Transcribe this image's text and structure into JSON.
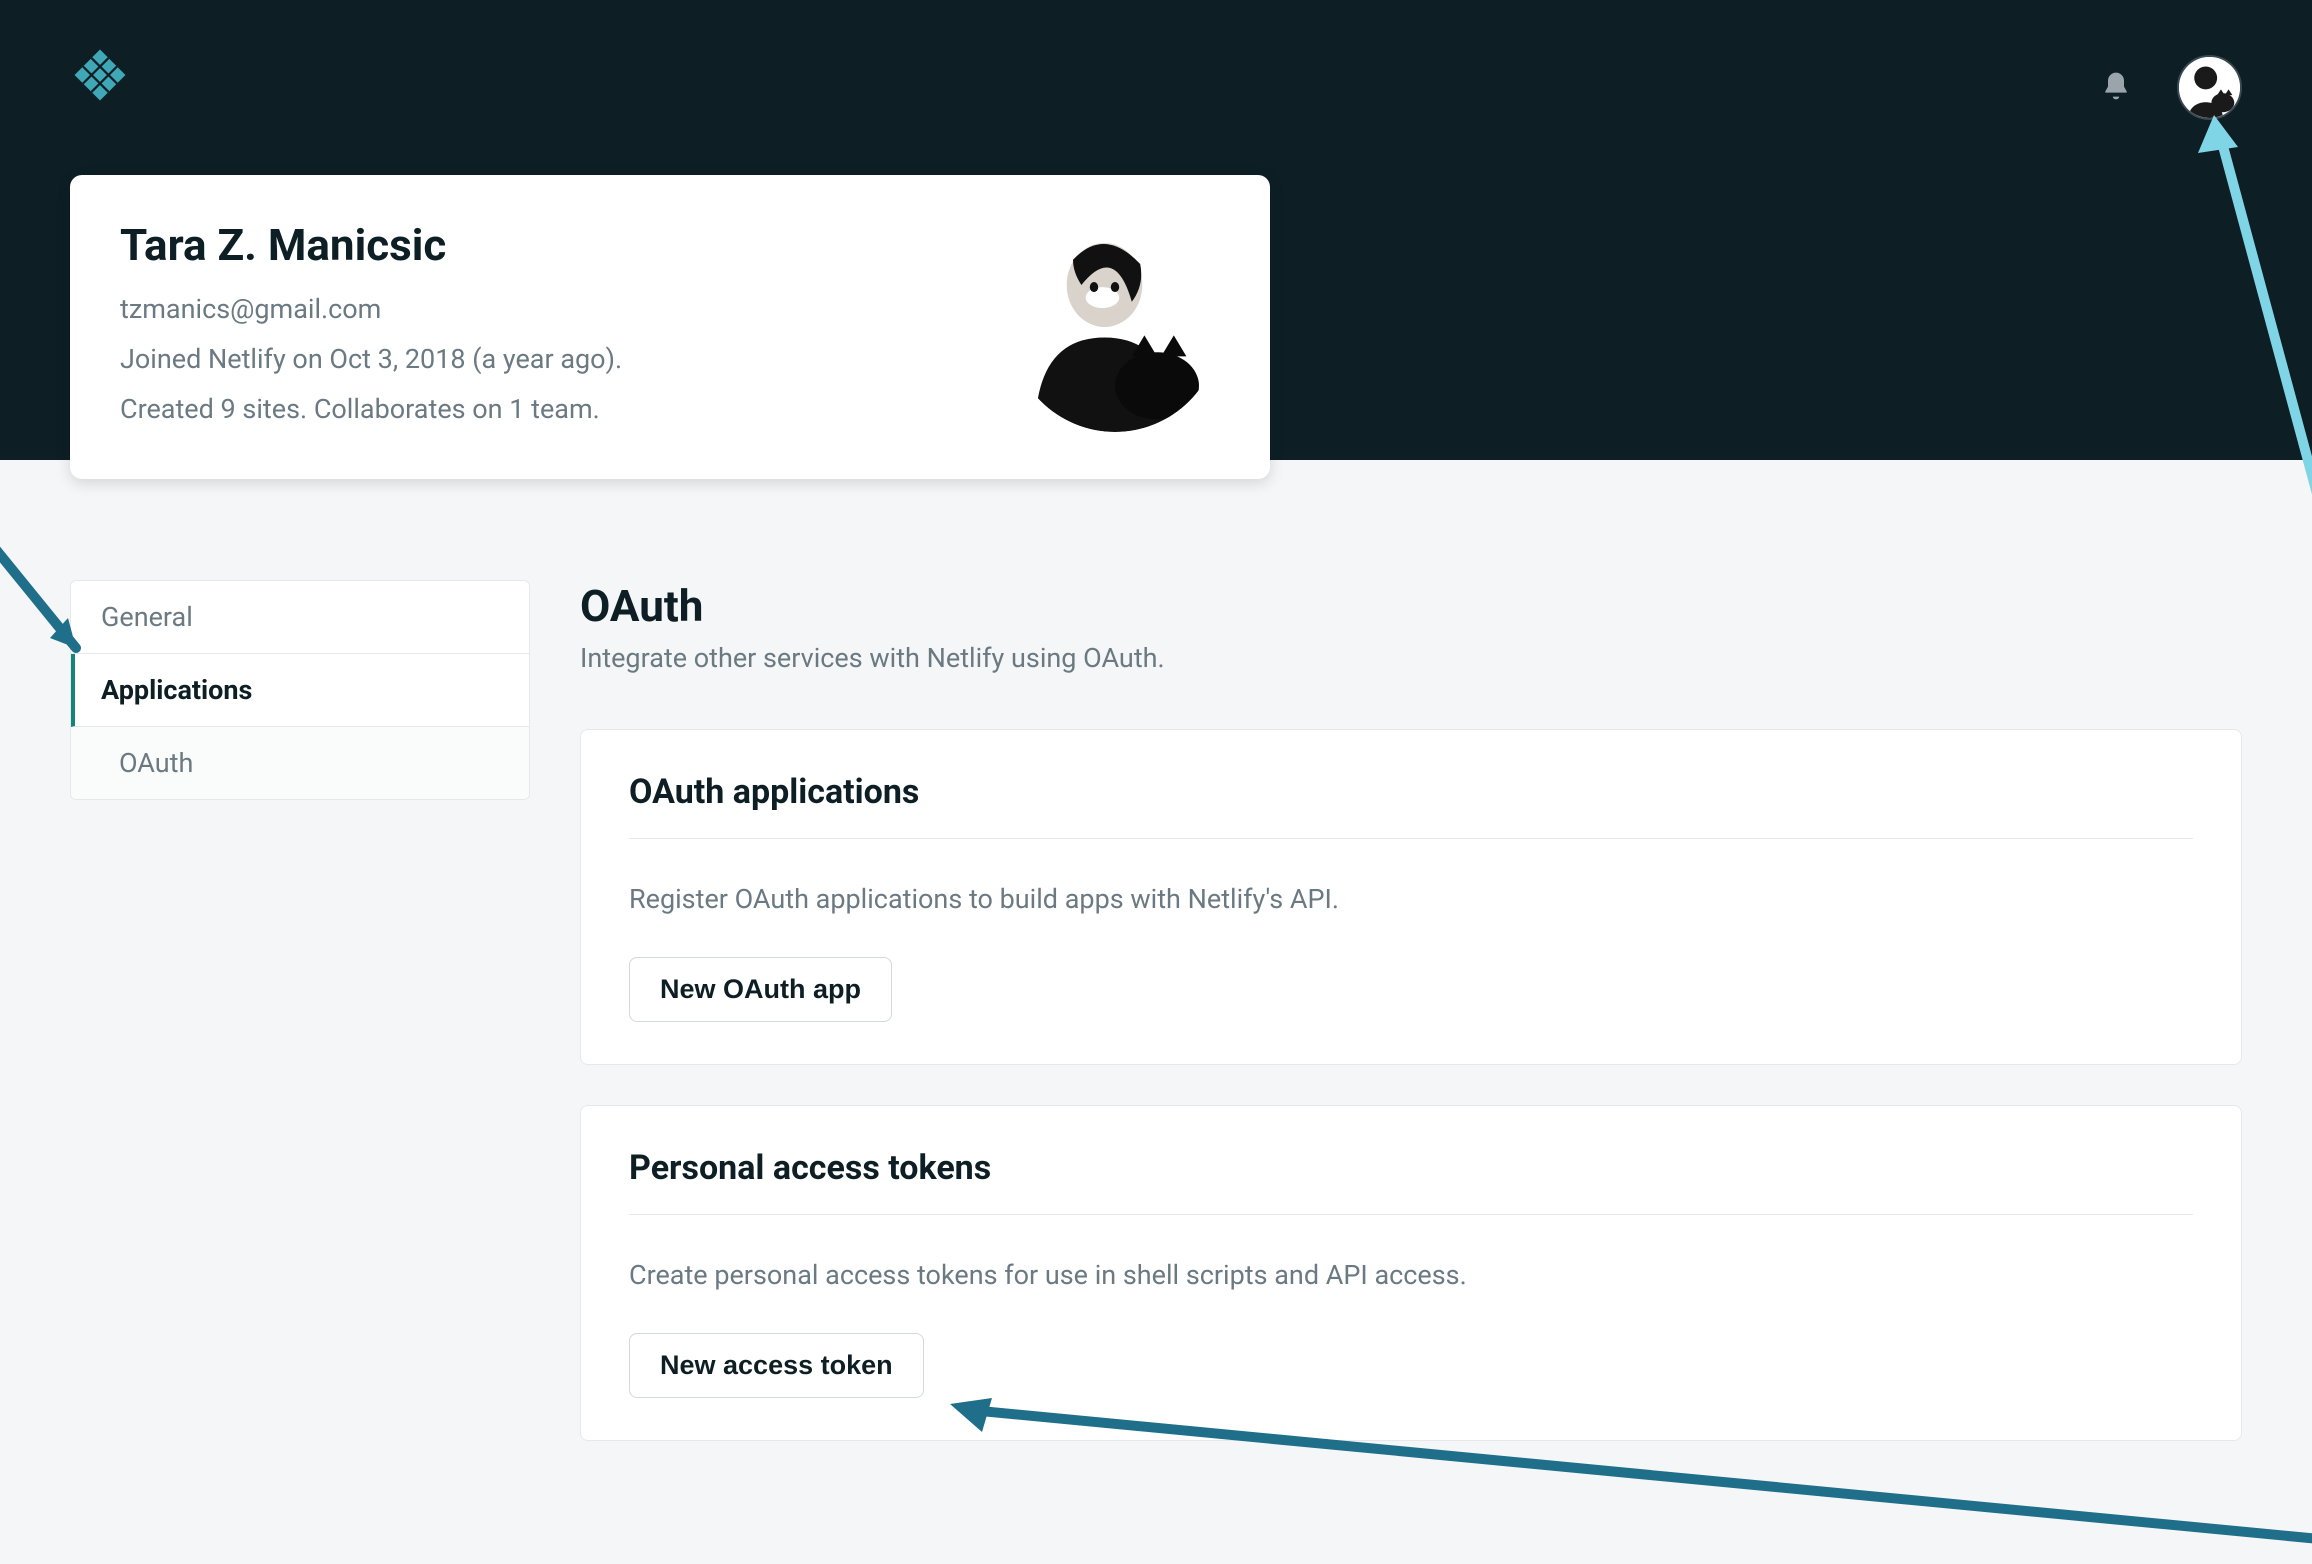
{
  "profile": {
    "name": "Tara Z. Manicsic",
    "email": "tzmanics@gmail.com",
    "joined": "Joined Netlify on Oct 3, 2018 (a year ago).",
    "stats": "Created 9 sites. Collaborates on 1 team."
  },
  "sidebar": {
    "items": [
      {
        "label": "General",
        "active": false
      },
      {
        "label": "Applications",
        "active": true
      }
    ],
    "subitems": [
      {
        "label": "OAuth"
      }
    ]
  },
  "page": {
    "title": "OAuth",
    "subtitle": "Integrate other services with Netlify using OAuth."
  },
  "panels": {
    "oauth_apps": {
      "heading": "OAuth applications",
      "description": "Register OAuth applications to build apps with Netlify's API.",
      "button": "New OAuth app"
    },
    "tokens": {
      "heading": "Personal access tokens",
      "description": "Create personal access tokens for use in shell scripts and API access.",
      "button": "New access token"
    }
  },
  "colors": {
    "brand_dark": "#0e1e25",
    "accent_teal": "#15847b",
    "arrow_dark": "#1f6f8b",
    "arrow_light": "#7fd4e6"
  }
}
